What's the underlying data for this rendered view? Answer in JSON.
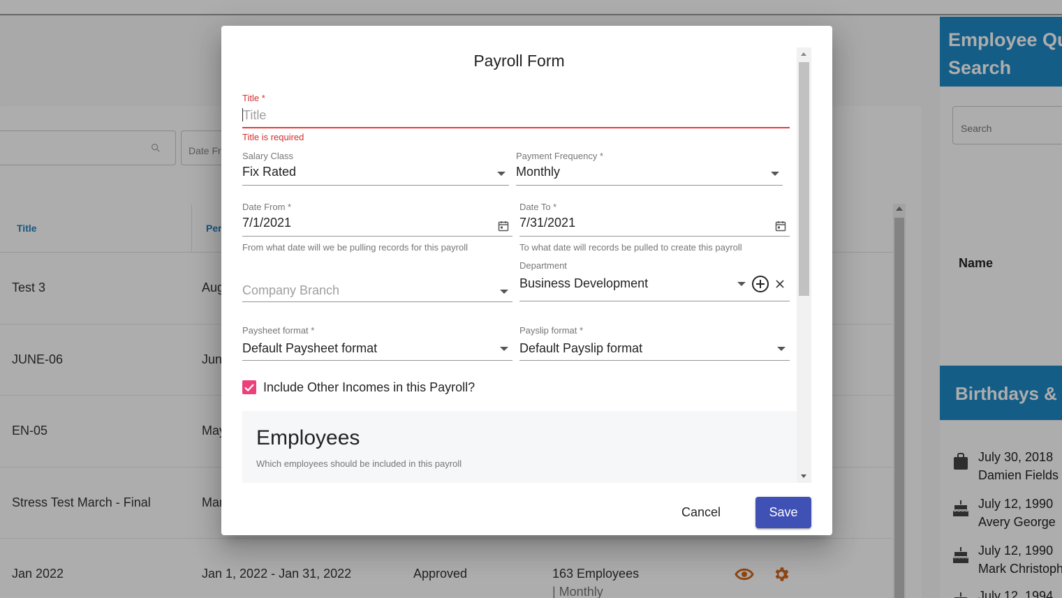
{
  "background": {
    "search_icon": "search-icon",
    "date_filter_placeholder": "Date Fr",
    "table": {
      "headers": [
        "Title",
        "Per"
      ],
      "rows": [
        {
          "title": "Test 3",
          "period": "Aug"
        },
        {
          "title": "JUNE-06",
          "period": "Jun"
        },
        {
          "title": "EN-05",
          "period": "May"
        },
        {
          "title": "Stress Test March - Final",
          "period": "Mar"
        },
        {
          "title": "Jan 2022",
          "period": "Jan 1, 2022 - Jan 31, 2022",
          "status": "Approved",
          "employees": "163 Employees",
          "frequency": "| Monthly"
        }
      ]
    },
    "action_icon_color": "#d2691e",
    "quick_search": {
      "title_line1": "Employee Qu",
      "title_line2": "Search",
      "search_placeholder": "Search",
      "name_header": "Name"
    },
    "birthdays": {
      "title": "Birthdays & A",
      "items": [
        {
          "date": "July 30, 2018",
          "name": "Damien Fields",
          "icon": "briefcase-icon"
        },
        {
          "date": "July 12, 1990",
          "name": "Avery George",
          "icon": "cake-icon"
        },
        {
          "date": "July 12, 1990",
          "name": "Mark Christoph",
          "icon": "cake-icon"
        },
        {
          "date": "July 12, 1994",
          "name": "",
          "icon": "cake-icon"
        }
      ]
    },
    "accent_color": "#1d8ac8"
  },
  "modal": {
    "title": "Payroll Form",
    "fields": {
      "title": {
        "label": "Title *",
        "placeholder": "Title",
        "value": "",
        "error": "Title is required"
      },
      "salary_class": {
        "label": "Salary Class",
        "value": "Fix Rated"
      },
      "payment_frequency": {
        "label": "Payment Frequency *",
        "value": "Monthly"
      },
      "date_from": {
        "label": "Date From *",
        "value": "7/1/2021",
        "hint": "From what date will we be pulling records for this payroll"
      },
      "date_to": {
        "label": "Date To *",
        "value": "7/31/2021",
        "hint": "To what date will records be pulled to create this payroll"
      },
      "company_branch": {
        "placeholder": "Company Branch"
      },
      "department": {
        "label": "Department",
        "value": "Business Development"
      },
      "paysheet_format": {
        "label": "Paysheet format *",
        "value": "Default Paysheet format"
      },
      "payslip_format": {
        "label": "Payslip format *",
        "value": "Default Payslip format"
      }
    },
    "include_other_incomes": {
      "label": "Include Other Incomes in this Payroll?",
      "checked": true
    },
    "employees": {
      "title": "Employees",
      "subtitle": "Which employees should be included in this payroll"
    },
    "buttons": {
      "cancel": "Cancel",
      "save": "Save"
    },
    "colors": {
      "error": "#d32f2f",
      "checkbox": "#ec407a",
      "save_button": "#3f51b5"
    }
  }
}
